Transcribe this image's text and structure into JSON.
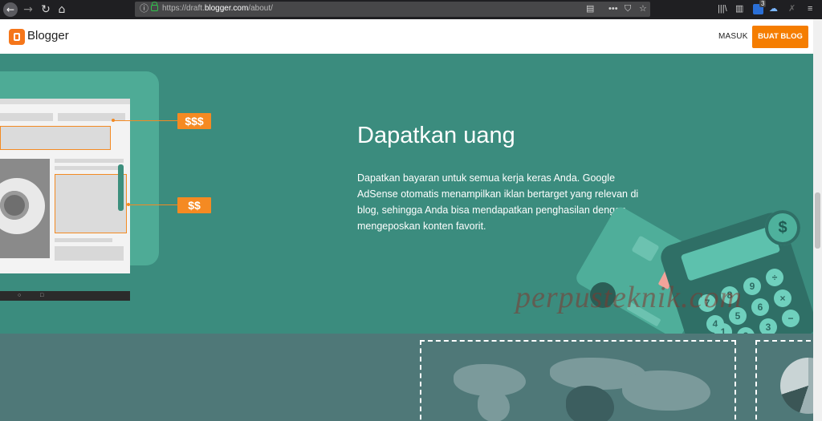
{
  "browser": {
    "url_prefix": "https://draft.",
    "url_host": "blogger.com",
    "url_path": "/about/",
    "tab_badge_count": "3",
    "icons": [
      "back-icon",
      "forward-icon",
      "reload-icon",
      "home-icon",
      "info-icon",
      "lock-icon",
      "reader-icon",
      "more-icon",
      "pocket-icon",
      "star-icon",
      "library-icon",
      "sidebar-icon",
      "extension-icon",
      "sync-icon",
      "menu-icon"
    ]
  },
  "header": {
    "brand": "Blogger",
    "login_label": "MASUK",
    "create_label": "BUAT BLOG",
    "accent": "#f57d00"
  },
  "hero": {
    "heading": "Dapatkan uang",
    "description": "Dapatkan bayaran untuk semua kerja keras Anda. Google AdSense otomatis menampilkan iklan bertarget yang relevan di blog, sehingga Anda bisa mendapatkan penghasilan dengan mengeposkan konten favorit.",
    "price_high": "$$$",
    "price_low": "$$",
    "background": "#3b8c7e"
  },
  "calculator": {
    "keys": [
      "7",
      "8",
      "9",
      "÷",
      "4",
      "5",
      "6",
      "×",
      "1",
      "2",
      "3",
      "−"
    ],
    "coin_symbol": "$"
  },
  "watermark": "perpusteknik.com",
  "lower_section": {
    "background": "#4f7878"
  }
}
